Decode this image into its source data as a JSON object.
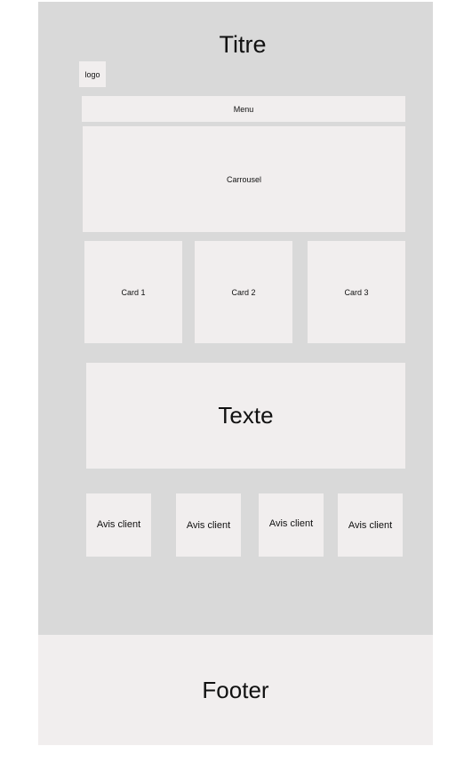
{
  "title": "Titre",
  "logo": "logo",
  "menu": "Menu",
  "carousel": "Carrousel",
  "cards": [
    "Card 1",
    "Card 2",
    "Card 3"
  ],
  "text_block": "Texte",
  "reviews": [
    "Avis client",
    "Avis client",
    "Avis client",
    "Avis client"
  ],
  "footer": "Footer",
  "colors": {
    "background": "#d9d9d9",
    "block": "#f1eeee",
    "text": "#111111"
  }
}
